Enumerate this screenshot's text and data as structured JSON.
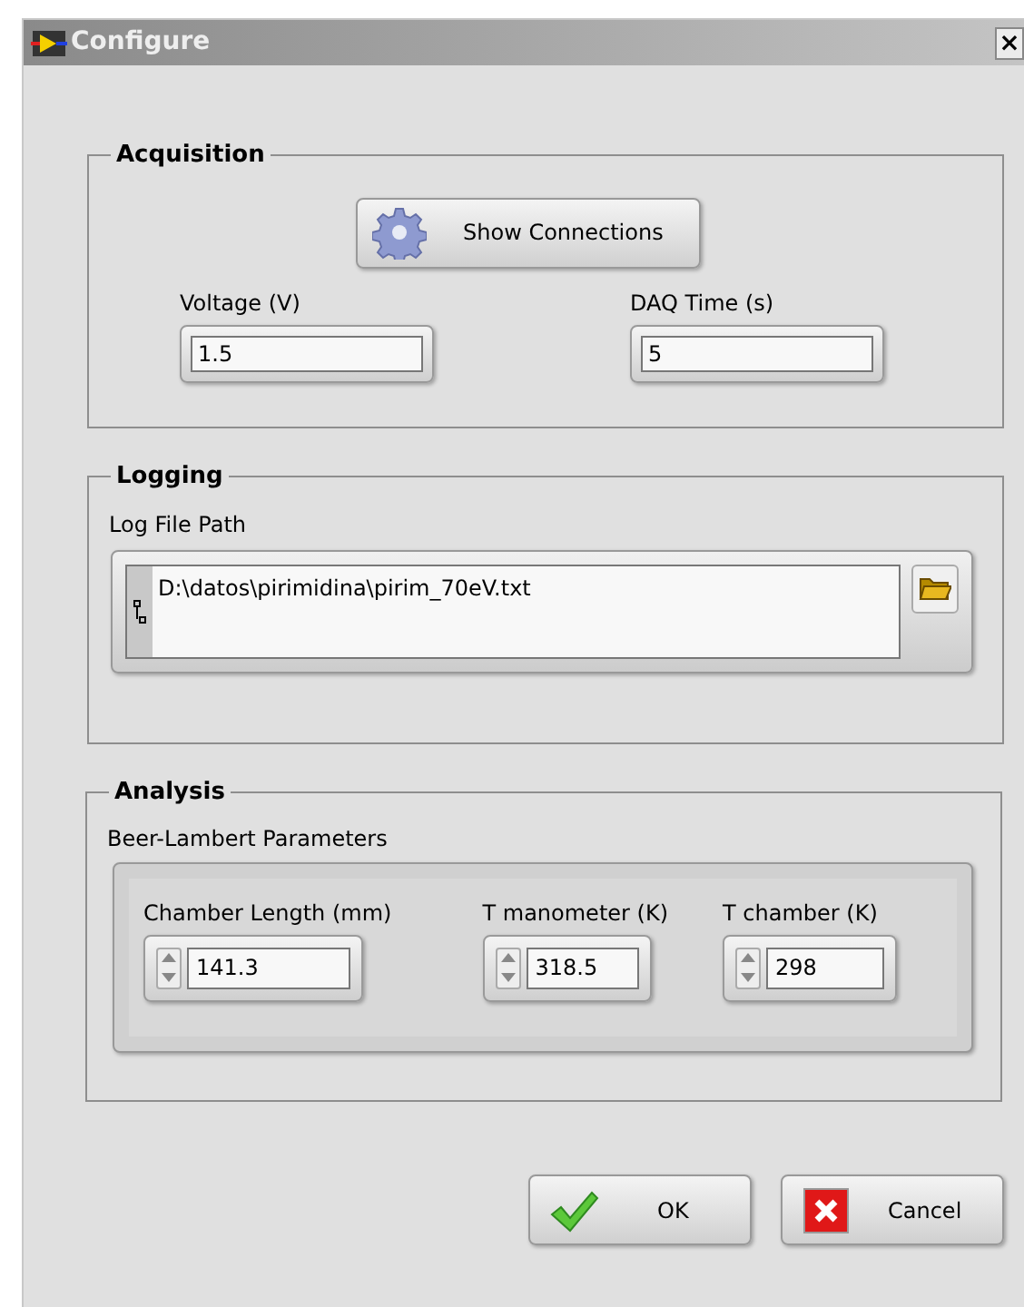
{
  "window": {
    "title": "Configure",
    "close": "×"
  },
  "acquisition": {
    "title": "Acquisition",
    "button": "Show Connections",
    "fields": [
      {
        "label": "Voltage (V)",
        "value": "1.5"
      },
      {
        "label": "DAQ Time (s)",
        "value": "5"
      }
    ]
  },
  "logging": {
    "title": "Logging",
    "label": "Log File Path",
    "value": "D:\\datos\\pirimidina\\pirim_70eV.txt"
  },
  "analysis": {
    "title": "Analysis",
    "subtitle": "Beer-Lambert Parameters",
    "fields": [
      {
        "label": "Chamber Length (mm)",
        "value": "141.3"
      },
      {
        "label": "T manometer (K)",
        "value": "318.5"
      },
      {
        "label": "T chamber (K)",
        "value": "298"
      }
    ]
  },
  "buttons": [
    {
      "kind": "ok",
      "label": "OK"
    },
    {
      "kind": "cancel",
      "label": "Cancel"
    }
  ]
}
